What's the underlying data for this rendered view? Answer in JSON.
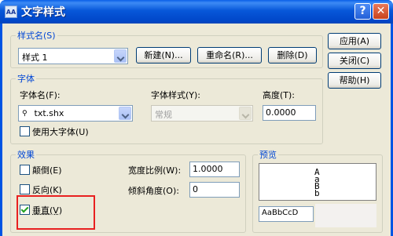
{
  "window": {
    "title": "文字样式",
    "help_glyph": "?",
    "close_glyph": "✕",
    "icon_label": "AA"
  },
  "style_group": {
    "legend": "样式名(S)",
    "selected_style": "样式 1",
    "new_button": "新建(N)...",
    "rename_button": "重命名(R)...",
    "delete_button": "删除(D)"
  },
  "right_buttons": {
    "apply": "应用(A)",
    "close": "关闭(C)",
    "help": "帮助(H)"
  },
  "font_group": {
    "legend": "字体",
    "font_name_label": "字体名(F):",
    "font_name_value": "txt.shx",
    "font_style_label": "字体样式(Y):",
    "font_style_value": "常规",
    "height_label": "高度(T):",
    "height_value": "0.0000",
    "bigfont_label": "使用大字体(U)"
  },
  "effects_group": {
    "legend": "效果",
    "upside_down_label": "颠倒(E)",
    "backwards_label": "反向(K)",
    "vertical_label": "垂直(V)",
    "width_factor_label": "宽度比例(W):",
    "width_factor_value": "1.0000",
    "oblique_label": "倾斜角度(O):",
    "oblique_value": "0",
    "upside_down_checked": false,
    "backwards_checked": false,
    "vertical_checked": true
  },
  "preview_group": {
    "legend": "预览",
    "sample_chars": [
      "A",
      "a",
      "B",
      "b"
    ],
    "preview_text": "AaBbCcD"
  },
  "colors": {
    "legend_blue": "#0046d5",
    "title_blue": "#0054e3",
    "highlight_red": "#e82020"
  }
}
